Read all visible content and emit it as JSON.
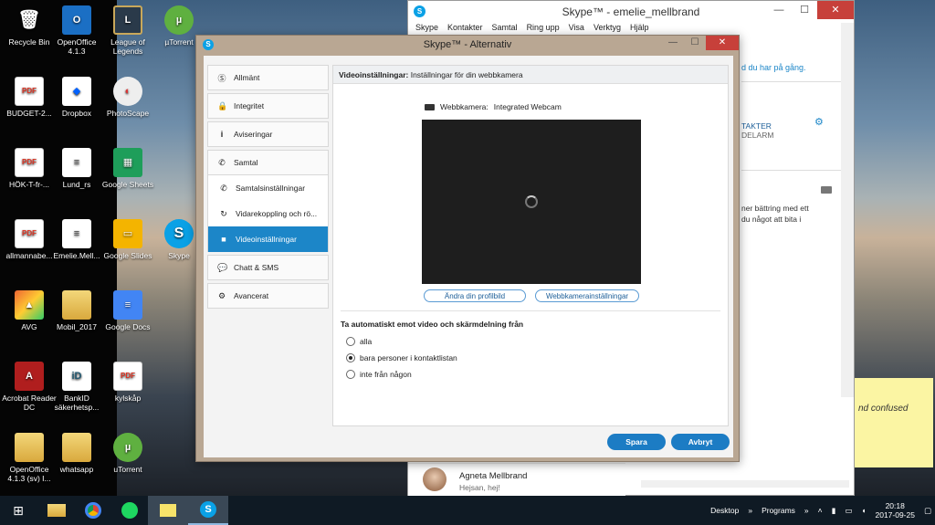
{
  "desktop_icons": [
    {
      "label": "Recycle Bin",
      "glyph": "🗑"
    },
    {
      "label": "OpenOffice 4.1.3",
      "glyph": "O"
    },
    {
      "label": "League of Legends",
      "glyph": "L"
    },
    {
      "label": "µTorrent",
      "glyph": "µ"
    },
    {
      "label": "BUDGET-2...",
      "glyph": "PDF"
    },
    {
      "label": "Dropbox",
      "glyph": "◆"
    },
    {
      "label": "PhotoScape",
      "glyph": "◐"
    },
    {
      "label": "HÖK-T-fr-...",
      "glyph": "PDF"
    },
    {
      "label": "Lund_rs",
      "glyph": "≡"
    },
    {
      "label": "Google Sheets",
      "glyph": "▦"
    },
    {
      "label": "allmannabe...",
      "glyph": "PDF"
    },
    {
      "label": "Emelie.Mell...",
      "glyph": "≡"
    },
    {
      "label": "Google Slides",
      "glyph": "▭"
    },
    {
      "label": "Skype",
      "glyph": "S"
    },
    {
      "label": "AVG",
      "glyph": "▲"
    },
    {
      "label": "Mobil_2017",
      "glyph": ""
    },
    {
      "label": "Google Docs",
      "glyph": "≡"
    },
    {
      "label": "Acrobat Reader DC",
      "glyph": "A"
    },
    {
      "label": "BankID säkerhetsp...",
      "glyph": "iD"
    },
    {
      "label": "kylskåp",
      "glyph": "PDF"
    },
    {
      "label": "OpenOffice 4.1.3 (sv) I...",
      "glyph": ""
    },
    {
      "label": "whatsapp",
      "glyph": ""
    },
    {
      "label": "uTorrent",
      "glyph": "µ"
    }
  ],
  "skype_main": {
    "title": "Skype™ - emelie_mellbrand",
    "menu": [
      "Skype",
      "Kontakter",
      "Samtal",
      "Ring upp",
      "Visa",
      "Verktyg",
      "Hjälp"
    ],
    "mood_snippet": "d du har på gång.",
    "contacts_snippet": "TAKTER",
    "alarm_snippet": "DELARM",
    "notice_snippet_1": "ner bättring med ett",
    "notice_snippet_2": "du något att bita i",
    "contact_name": "Agneta Mellbrand",
    "contact_message": "Hejsan, hej!"
  },
  "options": {
    "title": "Skype™ - Alternativ",
    "nav": {
      "allmant": "Allmänt",
      "integritet": "Integritet",
      "aviseringar": "Aviseringar",
      "samtal": "Samtal",
      "samtalsinstallningar": "Samtalsinställningar",
      "vidarekoppling": "Vidarekoppling och rö...",
      "videoinstallningar": "Videoinställningar",
      "chatt": "Chatt & SMS",
      "avancerat": "Avancerat"
    },
    "header_bold": "Videoinställningar:",
    "header_text": " Inställningar för din webbkamera",
    "webcam_label": "Webbkamera:",
    "webcam_value": "Integrated Webcam",
    "btn_profile": "Ändra din profilbild",
    "btn_webcam_settings": "Webbkamerainställningar",
    "auto_accept_title": "Ta automatiskt emot video och skärmdelning från",
    "radio_all": "alla",
    "radio_contacts": "bara personer i kontaktlistan",
    "radio_none": "inte från någon",
    "save": "Spara",
    "cancel": "Avbryt"
  },
  "sticky_note": "nd confused",
  "taskbar": {
    "desktop": "Desktop",
    "programs": "Programs",
    "time": "20:18",
    "date": "2017-09-25"
  }
}
